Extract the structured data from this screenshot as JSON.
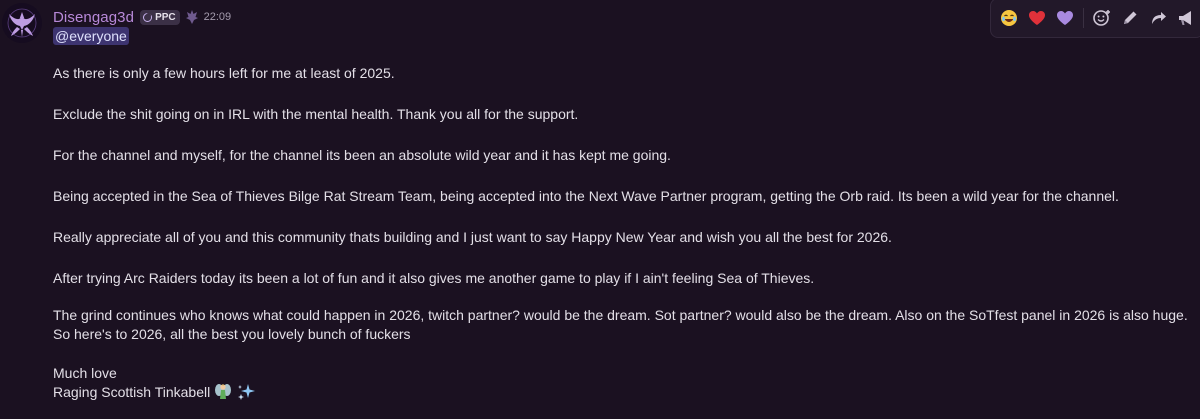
{
  "message": {
    "username": "Disengag3d",
    "tag": "PPC",
    "timestamp": "22:09",
    "mention": "@everyone",
    "paragraphs": [
      "As there is only a few hours left for me at least of 2025.",
      "Exclude the shit going on in IRL with the mental health. Thank you all for the support.",
      "For the channel and myself, for the channel its been an absolute wild year and it has kept me going.",
      "Being accepted in the Sea of Thieves Bilge Rat Stream Team, being accepted into the Next Wave Partner program, getting the Orb raid. Its been a wild year for the channel.",
      "Really appreciate all of you and this community thats building and I just want to say Happy New Year and wish you all the best for 2026.",
      "After trying Arc Raiders today its been a lot of fun and it also gives me another game to play if I ain't feeling Sea of Thieves.",
      "The grind continues who knows what could happen in 2026, twitch partner? would be the dream. Sot partner? would also be the dream. Also on the SoTfest panel in 2026 is also huge. So here's to 2026, all the best you lovely bunch of fuckers",
      "Much love",
      "Raging Scottish Tinkabell"
    ],
    "signature_emojis": [
      "fairy-emoji",
      "sparkles-emoji"
    ]
  },
  "toolbar": {
    "reactions": [
      "laughing-emoji",
      "red-heart-emoji",
      "purple-heart-emoji"
    ],
    "actions": [
      "add-reaction-icon",
      "edit-icon",
      "reply-icon",
      "forward-icon",
      "more-icon"
    ]
  },
  "colors": {
    "background": "#1b1121",
    "username": "#b889d9",
    "mention_bg": "#3d3470",
    "text": "#e3dfe7"
  }
}
